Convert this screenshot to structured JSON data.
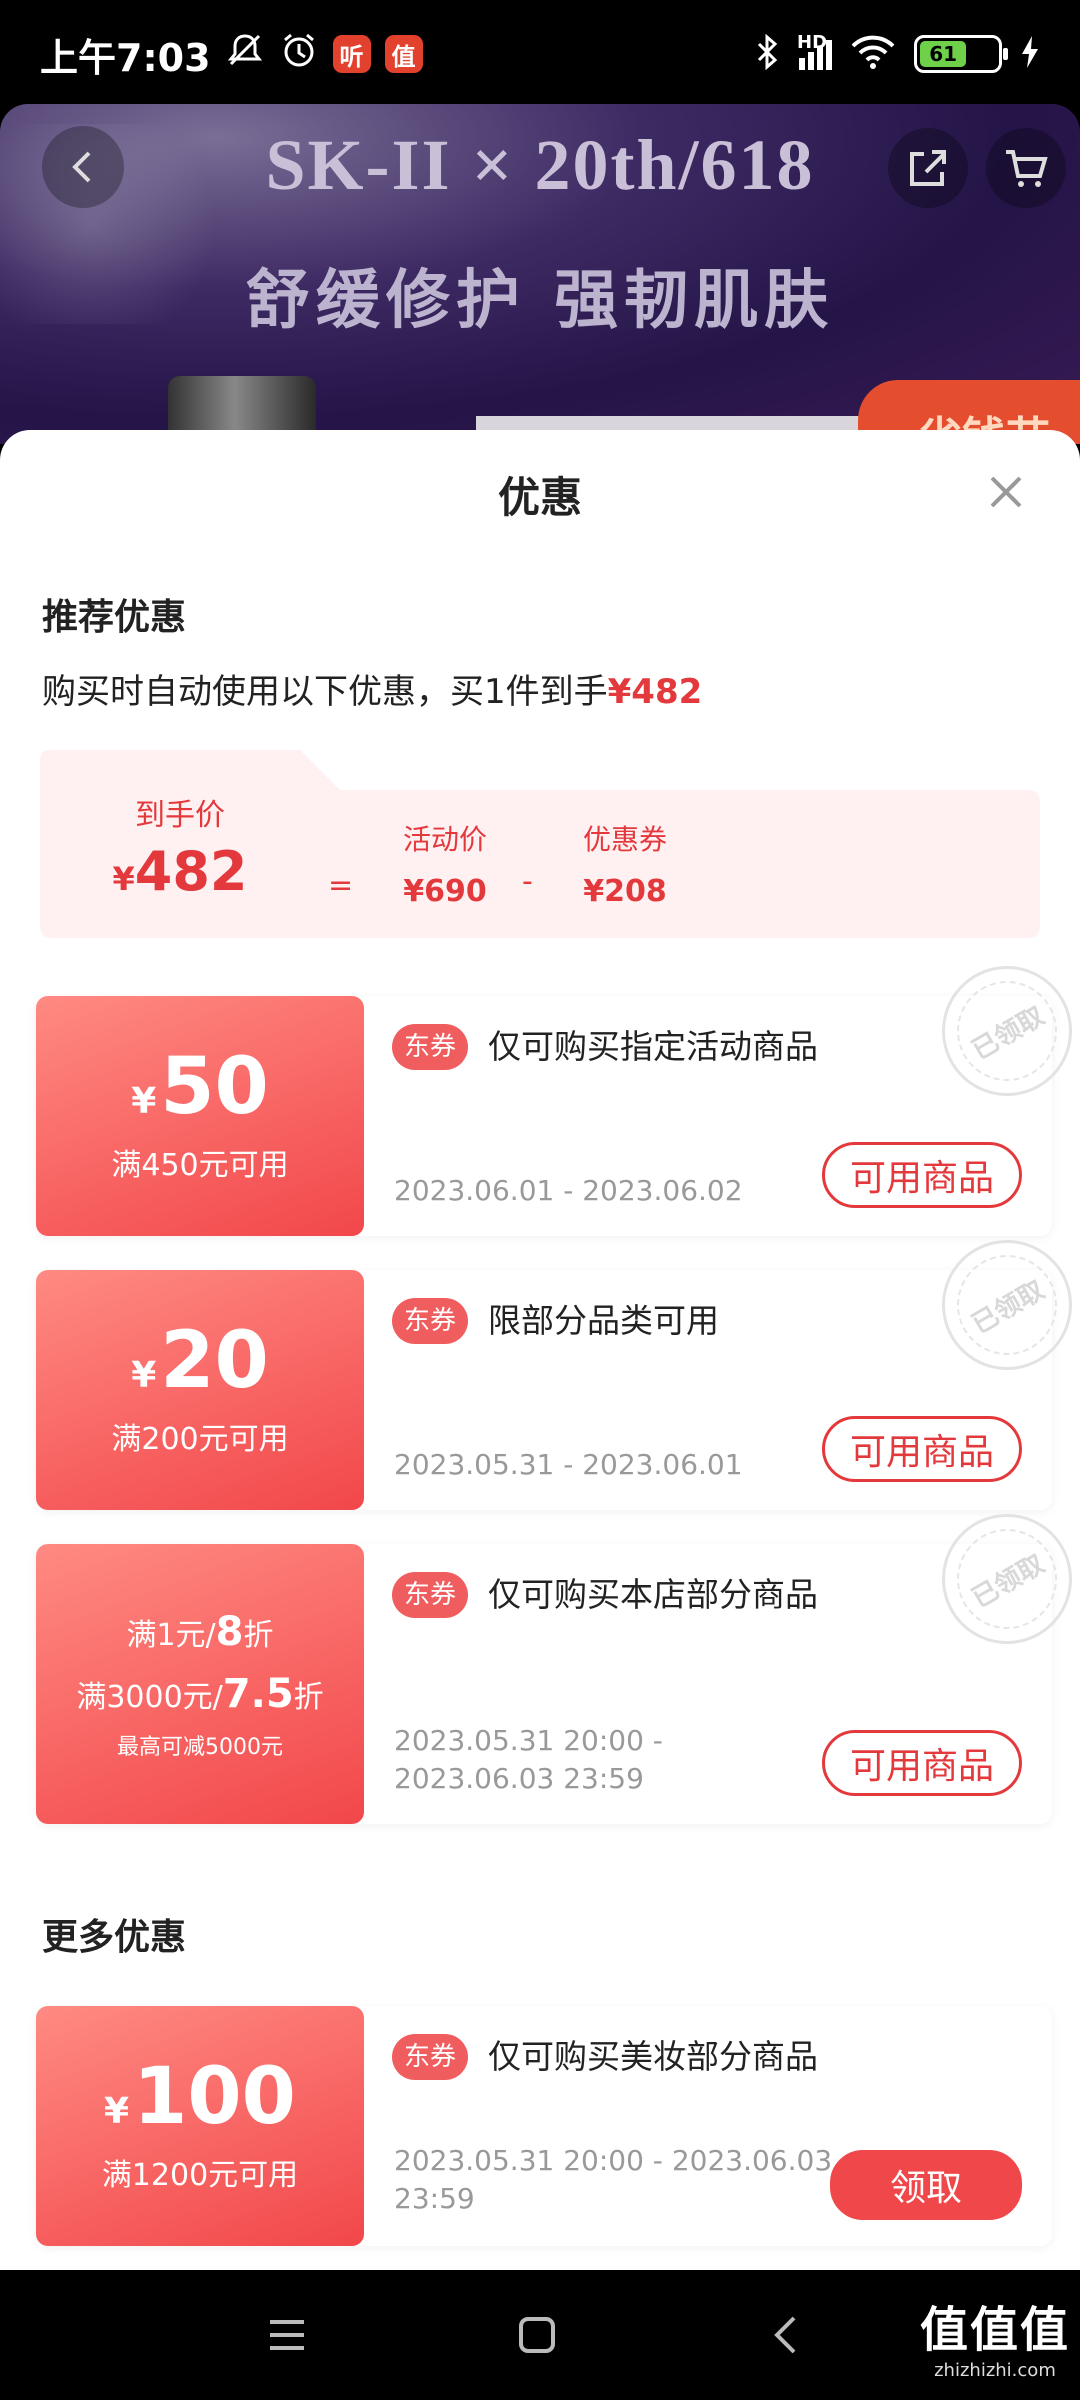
{
  "status_bar": {
    "time": "上午7:03",
    "app_badge_1": "听",
    "app_badge_2": "值",
    "network": "HD",
    "battery": "61",
    "icons": [
      "mute-icon",
      "alarm-icon",
      "bluetooth-icon",
      "signal-icon",
      "wifi-icon",
      "battery-icon",
      "charging-icon"
    ]
  },
  "banner": {
    "brand": "SK-II × 20th/618",
    "slogan": "舒缓修护 强韧肌肤",
    "tag": "省钱节"
  },
  "sheet": {
    "title": "优惠",
    "recommended_title": "推荐优惠",
    "summary_prefix": "购买时自动使用以下优惠，买1件到手",
    "summary_price": "¥482",
    "price_breakdown": {
      "final_label": "到手价",
      "final_currency": "¥",
      "final_value": "482",
      "equals": "=",
      "activity_label": "活动价",
      "activity_value": "¥690",
      "minus": "-",
      "coupon_label": "优惠券",
      "coupon_value": "¥208"
    },
    "more_title": "更多优惠"
  },
  "coupons": [
    {
      "currency": "¥",
      "amount": "50",
      "condition": "满450元可用",
      "tag": "东券",
      "description": "仅可购买指定活动商品",
      "date": "2023.06.01 - 2023.06.02",
      "button": "可用商品",
      "stamp": "已领取"
    },
    {
      "currency": "¥",
      "amount": "20",
      "condition": "满200元可用",
      "tag": "东券",
      "description": "限部分品类可用",
      "date": "2023.05.31 - 2023.06.01",
      "button": "可用商品",
      "stamp": "已领取"
    },
    {
      "line1_prefix": "满1元/",
      "line1_value": "8",
      "line1_suffix": "折",
      "line2_prefix": "满3000元/",
      "line2_value": "7.5",
      "line2_suffix": "折",
      "line3": "最高可减5000元",
      "tag": "东券",
      "description": "仅可购买本店部分商品",
      "date_line1": "2023.05.31 20:00 -",
      "date_line2": "2023.06.03 23:59",
      "button": "可用商品",
      "stamp": "已领取"
    },
    {
      "currency": "¥",
      "amount": "100",
      "condition": "满1200元可用",
      "tag": "东券",
      "description": "仅可购买美妆部分商品",
      "date_line1": "2023.05.31 20:00 - 2023.06.03",
      "date_line2": "23:59",
      "button": "领取"
    }
  ],
  "watermark": {
    "big": "值值值",
    "small": "zhizhizhi.com"
  },
  "colors": {
    "accent": "#e4393c",
    "coupon_gradient_start": "#ff8a83",
    "coupon_gradient_end": "#f2474a",
    "price_box_bg": "#fff1f1"
  }
}
